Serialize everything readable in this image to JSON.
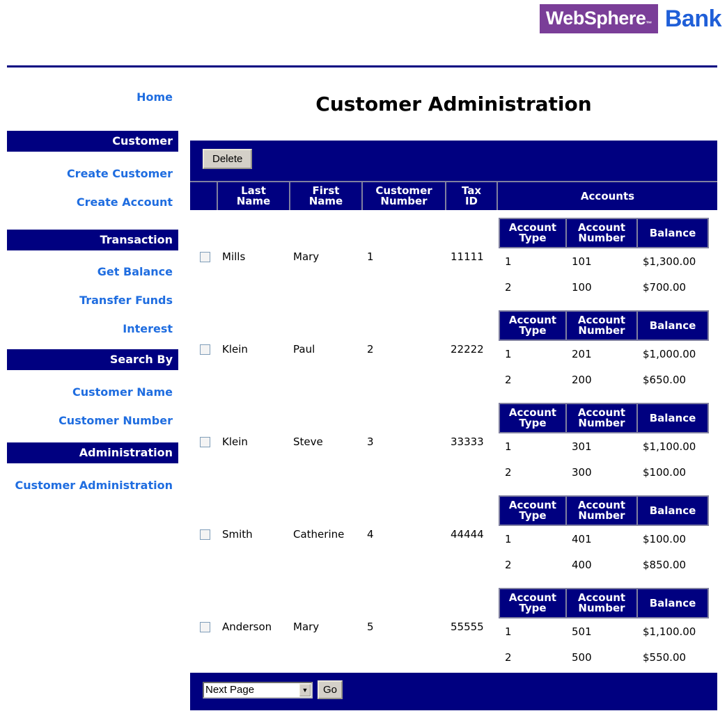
{
  "logo": {
    "websphere": "WebSphere",
    "bank": "Bank"
  },
  "page": {
    "title": "Customer Administration"
  },
  "sidebar": {
    "home": "Home",
    "sections": [
      {
        "title": "Customer",
        "links": [
          "Create Customer",
          "Create Account"
        ]
      },
      {
        "title": "Transaction",
        "links": [
          "Get Balance",
          "Transfer Funds",
          "Interest"
        ]
      },
      {
        "title": "Search By",
        "links": [
          "Customer Name",
          "Customer Number"
        ]
      },
      {
        "title": "Administration",
        "links": [
          "Customer Administration"
        ]
      }
    ]
  },
  "toolbar": {
    "delete_label": "Delete"
  },
  "table": {
    "headers": {
      "last": [
        "Last",
        "Name"
      ],
      "first": [
        "First",
        "Name"
      ],
      "number": [
        "Customer",
        "Number"
      ],
      "tax": [
        "Tax",
        "ID"
      ],
      "accounts": "Accounts"
    },
    "account_headers": {
      "type": [
        "Account",
        "Type"
      ],
      "number": [
        "Account",
        "Number"
      ],
      "balance": "Balance"
    },
    "rows": [
      {
        "last": "Mills",
        "first": "Mary",
        "number": "1",
        "tax": "11111",
        "accounts": [
          [
            "1",
            "101",
            "$1,300.00"
          ],
          [
            "2",
            "100",
            "$700.00"
          ]
        ]
      },
      {
        "last": "Klein",
        "first": "Paul",
        "number": "2",
        "tax": "22222",
        "accounts": [
          [
            "1",
            "201",
            "$1,000.00"
          ],
          [
            "2",
            "200",
            "$650.00"
          ]
        ]
      },
      {
        "last": "Klein",
        "first": "Steve",
        "number": "3",
        "tax": "33333",
        "accounts": [
          [
            "1",
            "301",
            "$1,100.00"
          ],
          [
            "2",
            "300",
            "$100.00"
          ]
        ]
      },
      {
        "last": "Smith",
        "first": "Catherine",
        "number": "4",
        "tax": "44444",
        "accounts": [
          [
            "1",
            "401",
            "$100.00"
          ],
          [
            "2",
            "400",
            "$850.00"
          ]
        ]
      },
      {
        "last": "Anderson",
        "first": "Mary",
        "number": "5",
        "tax": "55555",
        "accounts": [
          [
            "1",
            "501",
            "$1,100.00"
          ],
          [
            "2",
            "500",
            "$550.00"
          ]
        ]
      }
    ]
  },
  "footer": {
    "select_value": "Next Page",
    "go_label": "Go"
  }
}
